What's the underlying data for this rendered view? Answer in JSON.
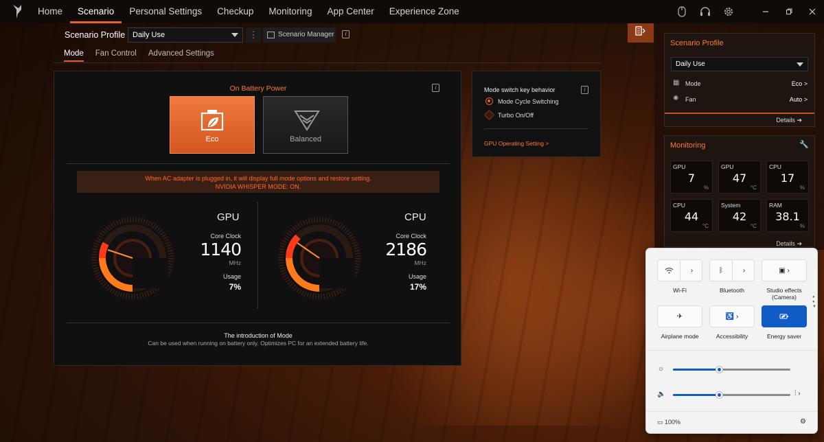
{
  "nav": {
    "items": [
      "Home",
      "Scenario",
      "Personal Settings",
      "Checkup",
      "Monitoring",
      "App Center",
      "Experience Zone"
    ],
    "active": "Scenario"
  },
  "profile_bar": {
    "label": "Scenario Profile",
    "selected": "Daily Use",
    "manager_label": "Scenario Manager"
  },
  "subtabs": [
    "Mode",
    "Fan Control",
    "Advanced Settings"
  ],
  "main": {
    "title": "On Battery Power",
    "modes": [
      {
        "label": "Eco",
        "selected": true
      },
      {
        "label": "Balanced",
        "selected": false
      }
    ],
    "alert_line1": "When AC adapter is plugged in, it will display full mode options and restore setting.",
    "alert_line2": "NVIDIA WHISPER MODE: ON.",
    "gpu": {
      "title": "GPU",
      "clock_label": "Core Clock",
      "clock": "1140",
      "unit": "MHz",
      "usage_label": "Usage",
      "usage": "7%"
    },
    "cpu": {
      "title": "CPU",
      "clock_label": "Core Clock",
      "clock": "2186",
      "unit": "MHz",
      "usage_label": "Usage",
      "usage": "17%"
    },
    "intro_title": "The introduction of Mode",
    "intro_desc": "Can be used when running on battery only. Optimizes PC for an extended battery life."
  },
  "mode_switch": {
    "title": "Mode switch key behavior",
    "options": [
      {
        "label": "Mode Cycle Switching",
        "selected": true
      },
      {
        "label": "Turbo On/Off",
        "selected": false
      }
    ],
    "link": "GPU Operating Setting >"
  },
  "right_panel": {
    "profile_title": "Scenario Profile",
    "profile_selected": "Daily Use",
    "mode_label": "Mode",
    "mode_value": "Eco >",
    "fan_label": "Fan",
    "fan_value": "Auto >",
    "details": "Details",
    "monitoring_title": "Monitoring",
    "metrics": [
      {
        "name": "GPU",
        "value": "7",
        "unit": "%"
      },
      {
        "name": "GPU",
        "value": "47",
        "unit": "°C"
      },
      {
        "name": "CPU",
        "value": "17",
        "unit": "%"
      },
      {
        "name": "CPU",
        "value": "44",
        "unit": "°C"
      },
      {
        "name": "System",
        "value": "42",
        "unit": "°C"
      },
      {
        "name": "RAM",
        "value": "38.1",
        "unit": "%"
      }
    ],
    "details2": "Details"
  },
  "quick_settings": {
    "tiles": [
      {
        "label": "Wi-Fi",
        "icon": "wifi-icon"
      },
      {
        "label": "Bluetooth",
        "icon": "bluetooth-icon"
      },
      {
        "label": "Studio effects (Camera)",
        "icon": "camera-effects-icon"
      },
      {
        "label": "Airplane mode",
        "icon": "airplane-icon"
      },
      {
        "label": "Accessibility",
        "icon": "accessibility-icon"
      },
      {
        "label": "Energy saver",
        "icon": "energy-saver-icon",
        "active": true
      }
    ],
    "brightness": 0.4,
    "volume": 0.4,
    "battery": "100%"
  },
  "colors": {
    "accent": "#e8602a",
    "windows_accent": "#0f5cc6"
  }
}
